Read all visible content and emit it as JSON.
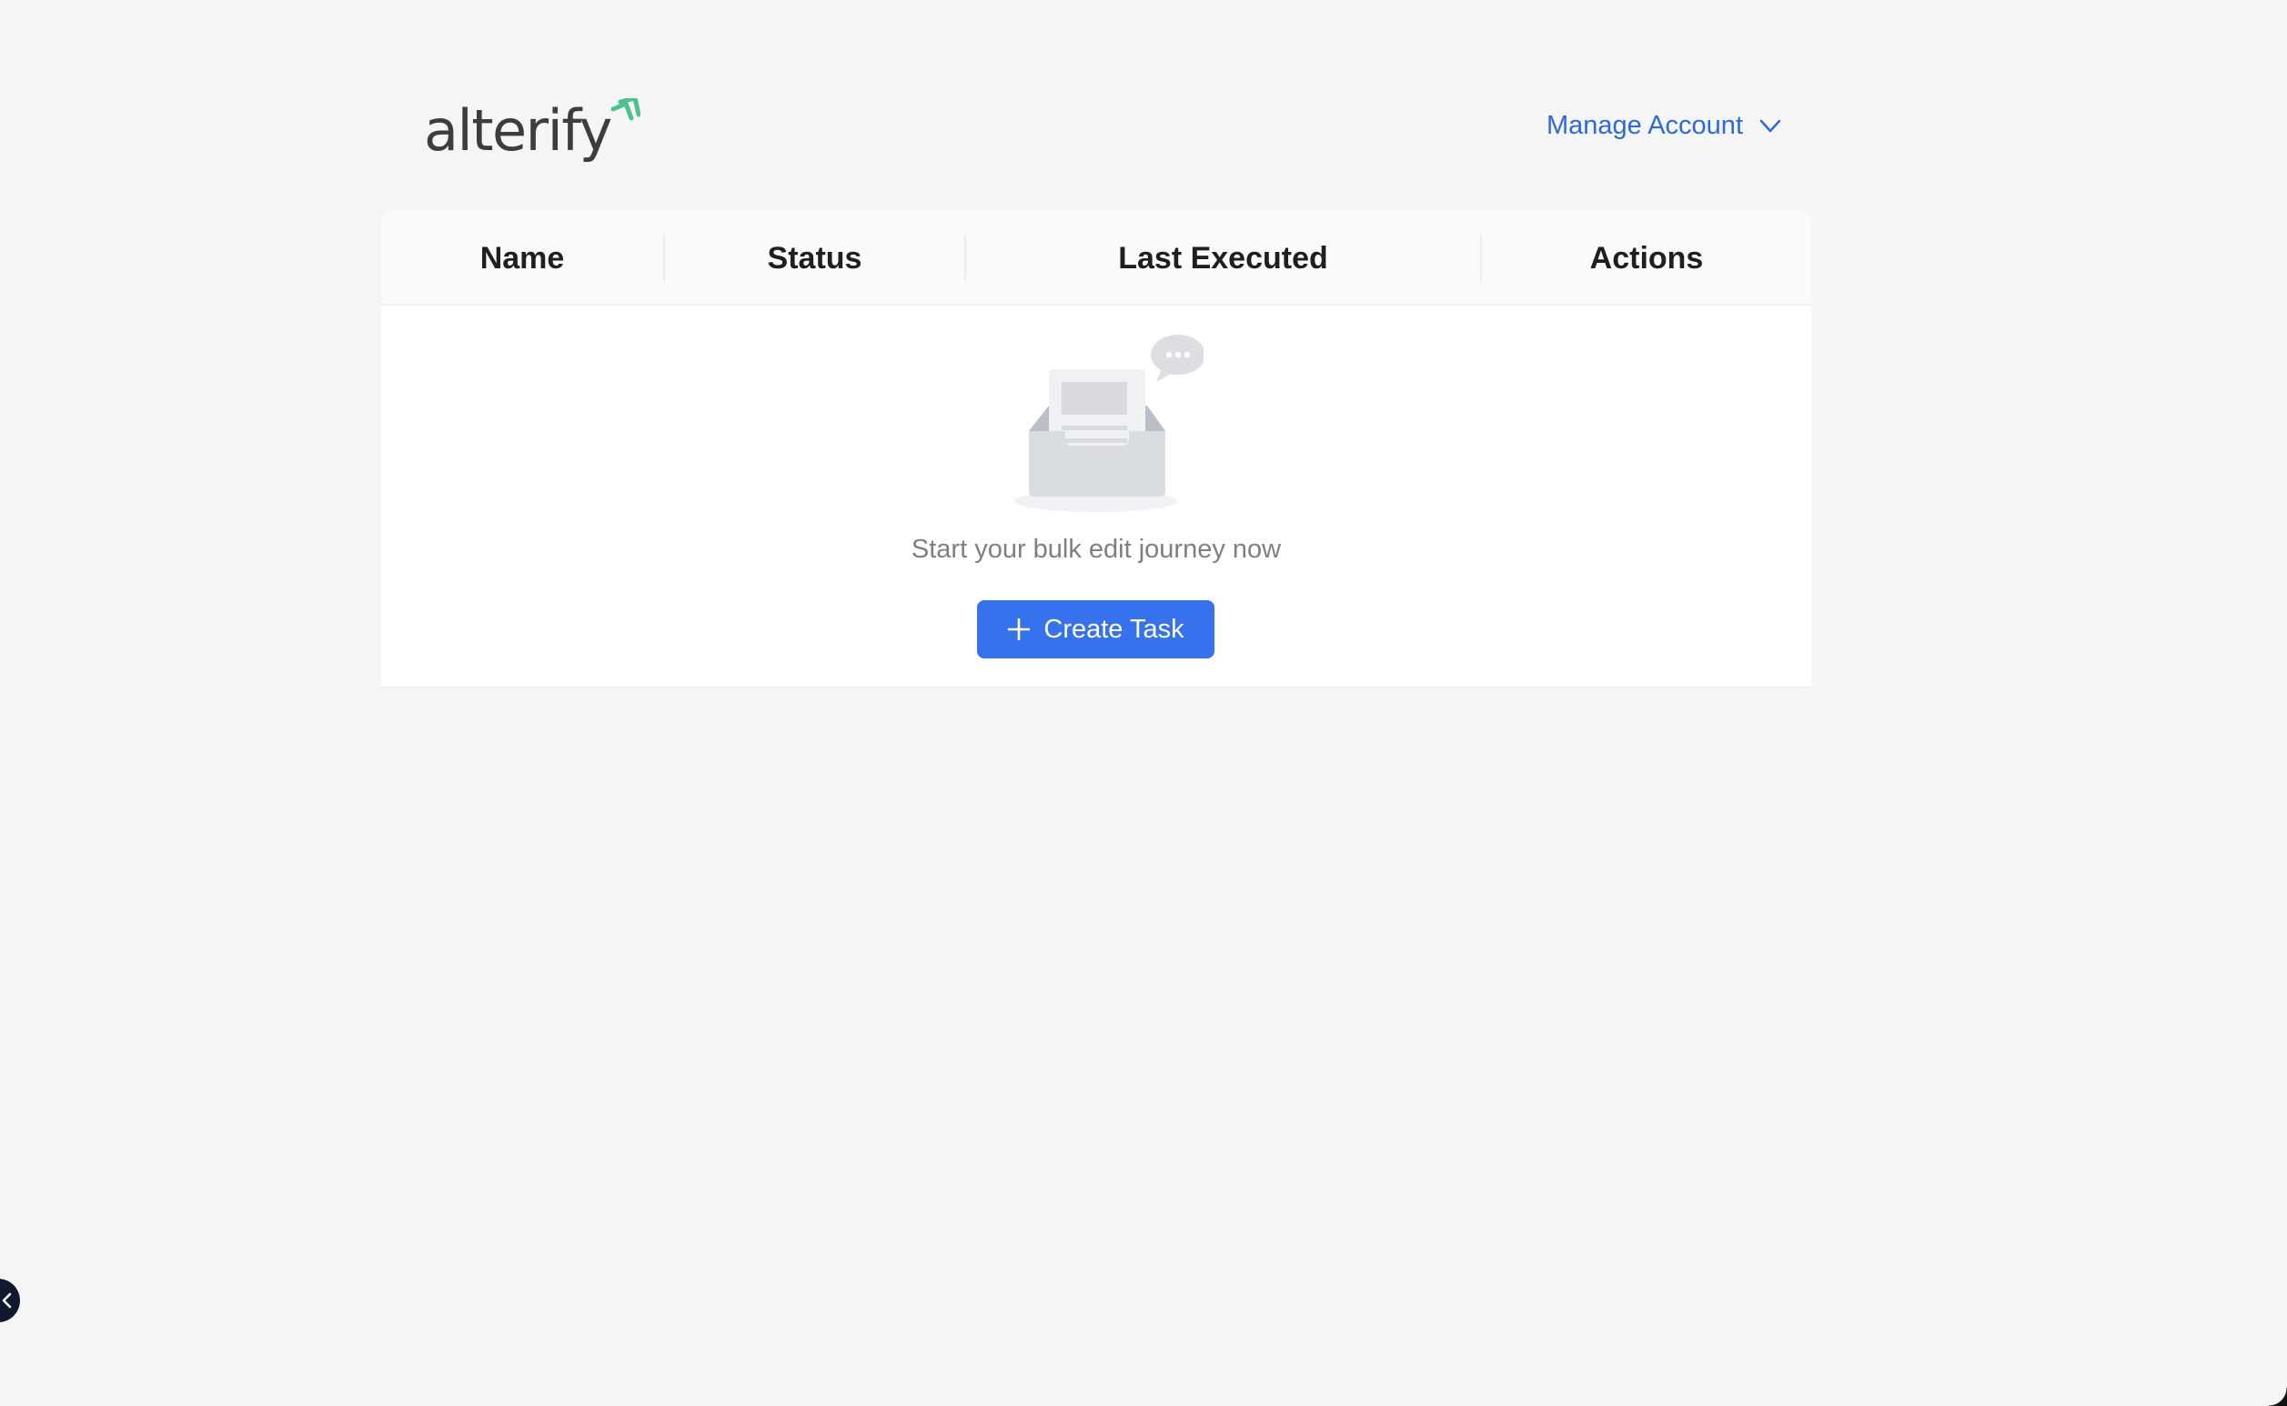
{
  "header": {
    "logo_text": "alterify",
    "manage_account_label": "Manage Account"
  },
  "table": {
    "columns": [
      "Name",
      "Status",
      "Last Executed",
      "Actions"
    ],
    "rows": []
  },
  "empty_state": {
    "message": "Start your bulk edit journey now",
    "create_button_label": "Create Task"
  },
  "colors": {
    "accent": "#3671ee",
    "link": "#2a69e0",
    "logo_mark": "#4cc38a",
    "background": "#f5f5f5"
  },
  "icons": {
    "logo_mark": "chevron-arrows-icon",
    "manage_account_caret": "chevron-down-icon",
    "create_button": "plus-icon",
    "empty_state": "empty-inbox-icon",
    "side_toggle": "chevron-left-icon"
  }
}
